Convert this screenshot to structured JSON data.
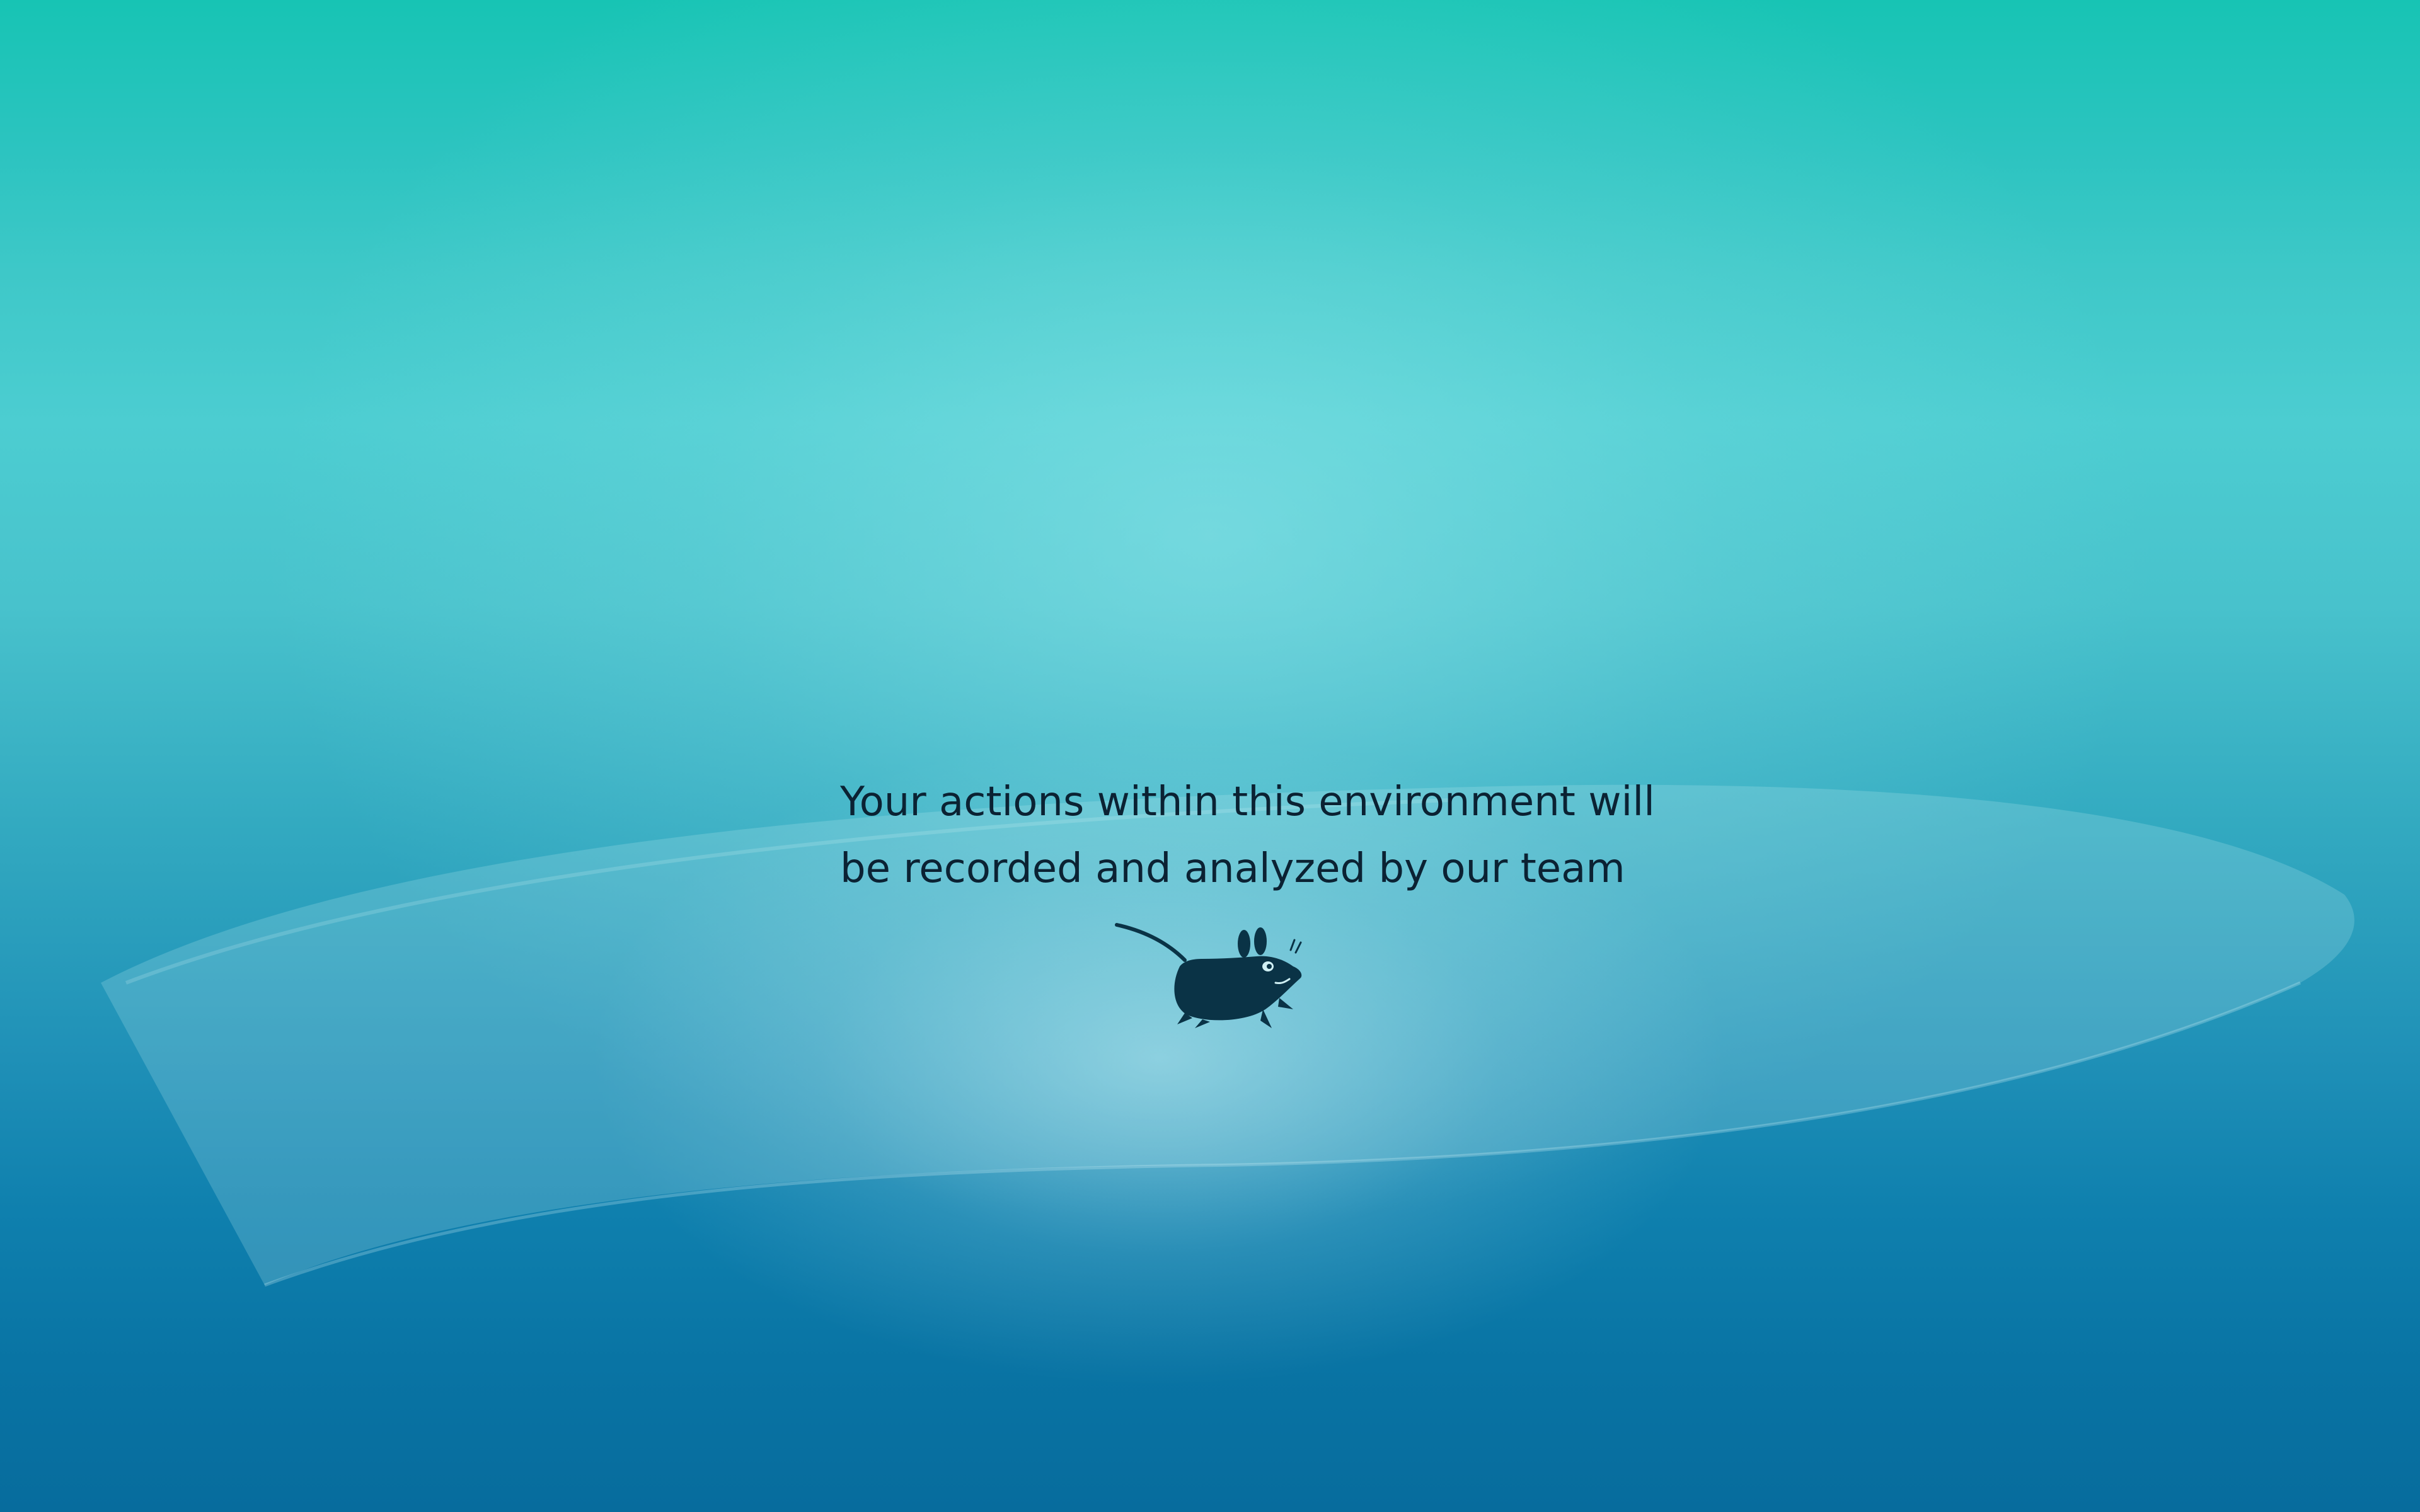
{
  "desktop": {
    "notice_line_1": "Your actions within this environment will",
    "notice_line_2": "be recorded and analyzed by our team",
    "logo_icon": "xfce-mouse-icon"
  },
  "colors": {
    "top": "#17c4b4",
    "middle": "#4ccdd1",
    "bottom": "#076c9d",
    "text": "#0b2233",
    "logo": "#0a3346"
  }
}
